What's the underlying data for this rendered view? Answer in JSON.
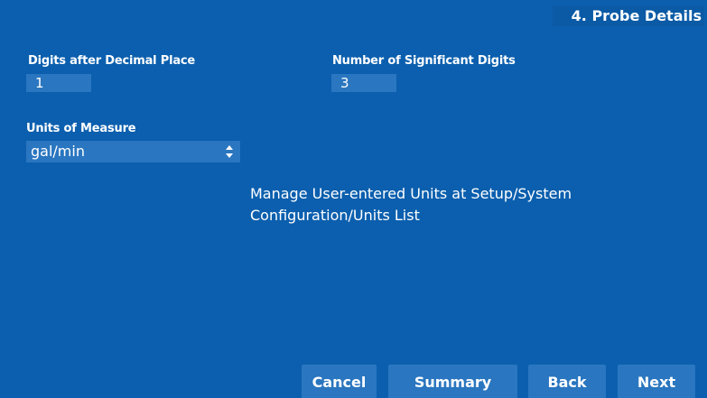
{
  "header": {
    "step_title": "4. Probe Details"
  },
  "fields": {
    "digits_after_decimal": {
      "label": "Digits after Decimal Place",
      "value": "1"
    },
    "significant_digits": {
      "label": "Number of Significant Digits",
      "value": "3"
    },
    "units_of_measure": {
      "label": "Units of Measure",
      "selected": "gal/min"
    }
  },
  "info": {
    "message": "Manage User-entered Units at Setup/System Configuration/Units List"
  },
  "footer": {
    "buttons": {
      "cancel": "Cancel",
      "summary": "Summary",
      "back": "Back",
      "next": "Next"
    }
  },
  "colors": {
    "background": "#0b5fae",
    "control": "#2a76c0",
    "text": "#ffffff"
  }
}
